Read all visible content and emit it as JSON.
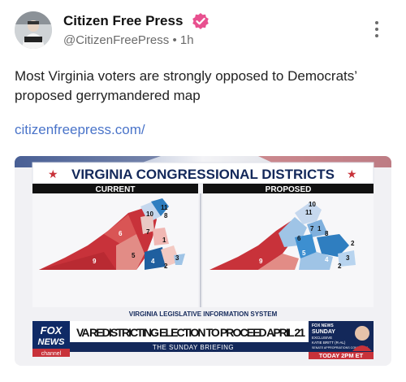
{
  "account": {
    "name": "Citizen Free Press",
    "handle": "@CitizenFreePress",
    "separator": "•",
    "time": "1h",
    "verified_color": "#e8508f"
  },
  "post": {
    "text": "Most Virginia voters are strongly opposed to Democrats’ proposed gerrymandered map",
    "link": "citizenfreepress.com/"
  },
  "image": {
    "title": "VIRGINIA CONGRESSIONAL DISTRICTS",
    "current_label": "CURRENT",
    "proposed_label": "PROPOSED",
    "current_districts": [
      "11",
      "10",
      "8",
      "7",
      "6",
      "1",
      "9",
      "5",
      "4",
      "3",
      "2"
    ],
    "proposed_districts": [
      "10",
      "11",
      "7",
      "1",
      "8",
      "6",
      "2",
      "5",
      "9",
      "4",
      "3",
      "2"
    ],
    "source_line": "VIRGINIA LEGISLATIVE INFORMATION SYSTEM",
    "network": {
      "line1": "FOX",
      "line2": "NEWS",
      "line3": "channel"
    },
    "headline": "VA REDISTRICTING ELECTION TO PROCEED APRIL 21",
    "show_name": "THE SUNDAY BRIEFING",
    "promo": {
      "header": "FOX NEWS",
      "show": "SUNDAY",
      "exclusive": "EXCLUSIVE",
      "guest": "KATIE BRITT (R-AL)",
      "guest_role": "SENATE APPROPRIATIONS COMMITTEE",
      "time": "TODAY 2PM ET"
    },
    "colors": {
      "red": "#c8323a",
      "blue": "#2f7ec0",
      "navy": "#13285a"
    }
  }
}
